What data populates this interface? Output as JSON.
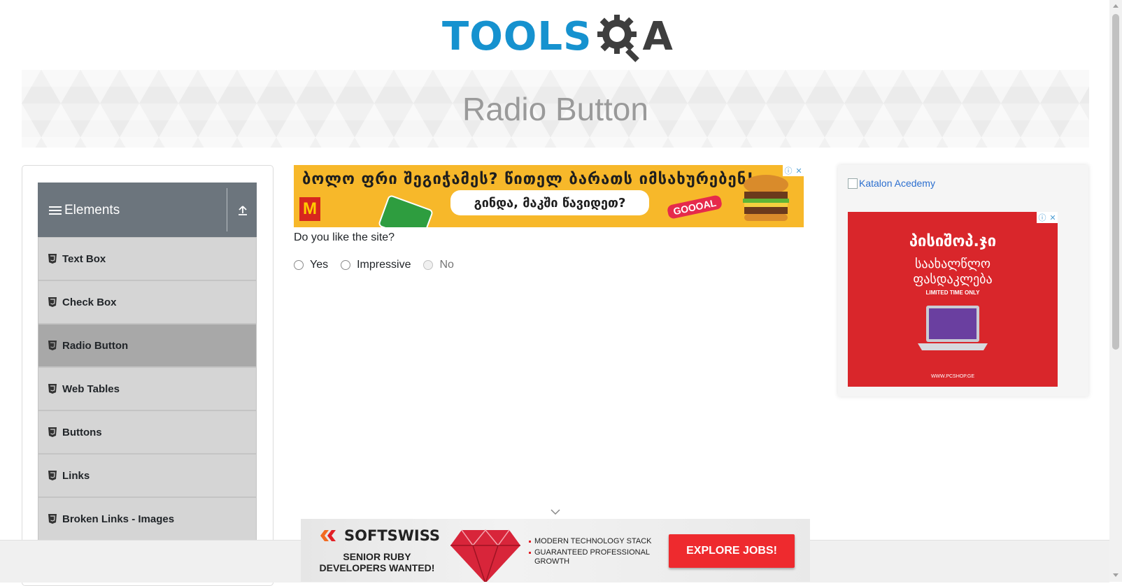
{
  "header": {
    "logo_part1": "TOOLS",
    "logo_part2": "A",
    "logo_primary_color": "#1692cf",
    "logo_secondary_color": "#3e3e3e"
  },
  "banner": {
    "title": "Radio Button"
  },
  "sidebar": {
    "group_title": "Elements",
    "group_icon": "hamburger-icon",
    "collapse_icon": "upload-arrow-icon",
    "items": [
      {
        "label": "Text Box",
        "active": false
      },
      {
        "label": "Check Box",
        "active": false
      },
      {
        "label": "Radio Button",
        "active": true
      },
      {
        "label": "Web Tables",
        "active": false
      },
      {
        "label": "Buttons",
        "active": false
      },
      {
        "label": "Links",
        "active": false
      },
      {
        "label": "Broken Links - Images",
        "active": false
      }
    ]
  },
  "top_ad": {
    "headline": "ბოლო ფრი შეგიჭამეს? წითელ ბარათს იმსახურებენ!",
    "bubble": "გინდა, მაკში წავიდეთ?",
    "badge": "GOOOAL"
  },
  "main": {
    "question": "Do you like the site?",
    "options": [
      {
        "label": "Yes",
        "disabled": false,
        "checked": false
      },
      {
        "label": "Impressive",
        "disabled": false,
        "checked": false
      },
      {
        "label": "No",
        "disabled": true,
        "checked": false
      }
    ]
  },
  "right_ad": {
    "link_text": "Katalon Acedemy",
    "xmas": {
      "brand": "პისიშოპ.ჯი",
      "sale_line1": "საახალწლო",
      "sale_line2": "ფასდაკლება",
      "limited": "LIMITED TIME ONLY",
      "url": "WWW.PCSHOP.GE"
    }
  },
  "bottom_ad": {
    "brand": "SOFTSWISS",
    "tagline_line1": "SENIOR RUBY",
    "tagline_line2": "DEVELOPERS WANTED!",
    "bullets": [
      "MODERN TECHNOLOGY STACK",
      "GUARANTEED PROFESSIONAL GROWTH"
    ],
    "cta": "EXPLORE JOBS!"
  }
}
